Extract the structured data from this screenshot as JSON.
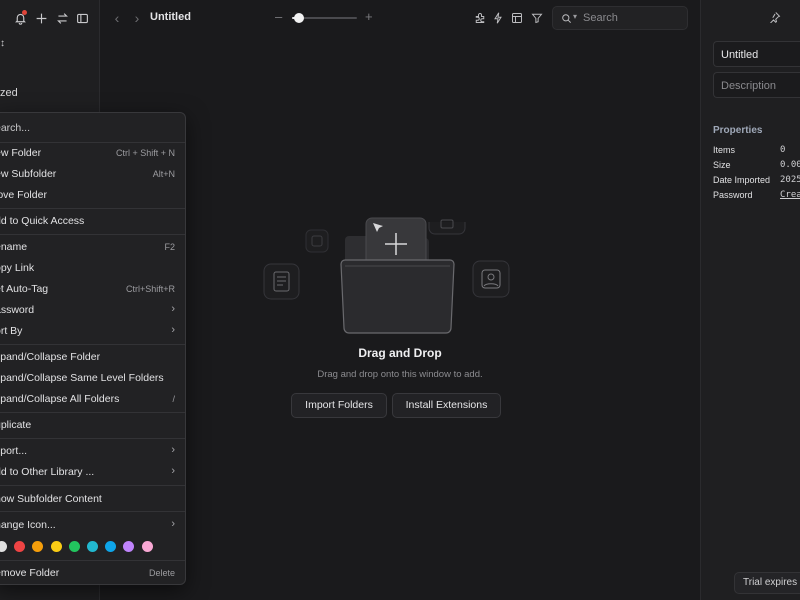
{
  "topbar": {
    "title": "Untitled",
    "zoom_level": 0.1,
    "search_placeholder": "Search",
    "icons": [
      "back-icon",
      "forward-icon",
      "puzzle-icon",
      "bolt-icon",
      "layout-icon",
      "filter-icon",
      "search-icon"
    ]
  },
  "sidebar": {
    "icons": [
      "bell-icon",
      "plus-icon",
      "swap-icon",
      "sidebar-toggle-icon"
    ],
    "library_label": "↕",
    "uncategorized_label": "zed"
  },
  "context_menu": {
    "search_placeholder": "earch...",
    "items": [
      {
        "label": "ew Folder",
        "shortcut": "Ctrl + Shift + N"
      },
      {
        "label": "ew Subfolder",
        "shortcut": "Alt+N"
      },
      {
        "label": "love Folder",
        "shortcut": ""
      },
      {
        "label": "dd to Quick Access",
        "shortcut": ""
      },
      {
        "label": "ename",
        "shortcut": "F2"
      },
      {
        "label": "opy Link",
        "shortcut": ""
      },
      {
        "label": "et Auto-Tag",
        "shortcut": "Ctrl+Shift+R"
      },
      {
        "label": "assword",
        "shortcut": ""
      },
      {
        "label": "ort By",
        "shortcut": ""
      },
      {
        "label": "xpand/Collapse Folder",
        "shortcut": ""
      },
      {
        "label": "xpand/Collapse Same Level Folders",
        "shortcut": ""
      },
      {
        "label": "xpand/Collapse All Folders",
        "shortcut": "/"
      },
      {
        "label": "uplicate",
        "shortcut": ""
      },
      {
        "label": "xport...",
        "shortcut": ""
      },
      {
        "label": "dd to Other Library ...",
        "shortcut": ""
      },
      {
        "label": "how Subfolder Content",
        "shortcut": ""
      },
      {
        "label": "hange Icon...",
        "shortcut": ""
      },
      {
        "label": "emove Folder",
        "shortcut": "Delete"
      }
    ],
    "colors": [
      "#e0e0e0",
      "#ef4444",
      "#f59e0b",
      "#facc15",
      "#22c55e",
      "#22b8cf",
      "#0ea5e9",
      "#c084fc",
      "#f9a8d4"
    ]
  },
  "empty_state": {
    "title": "Drag and Drop",
    "subtitle": "Drag and drop onto this window to add.",
    "import_button": "Import Folders",
    "extensions_button": "Install Extensions"
  },
  "inspector": {
    "name_value": "Untitled",
    "description_placeholder": "Description",
    "properties_title": "Properties",
    "properties": [
      {
        "label": "Items",
        "value": "0"
      },
      {
        "label": "Size",
        "value": "0.00"
      },
      {
        "label": "Date Imported",
        "value": "2025"
      },
      {
        "label": "Password",
        "value": "Crea"
      }
    ]
  },
  "footer": {
    "trial_text": "Trial expires in"
  }
}
